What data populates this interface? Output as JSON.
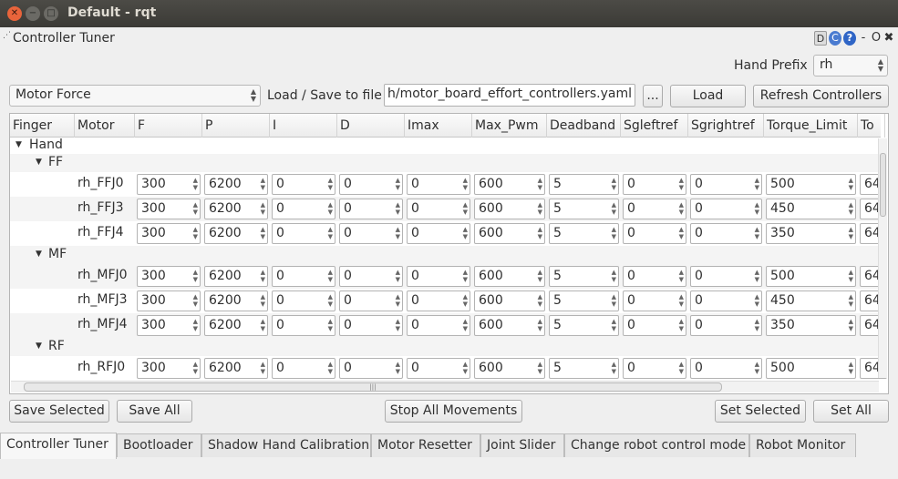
{
  "window": {
    "title": "Default - rqt"
  },
  "plugin": {
    "title": "Controller Tuner",
    "tool_d": "D",
    "tool_c": "C",
    "tool_q": "?",
    "tool_min": "-",
    "tool_float": "O",
    "tool_close": "✖"
  },
  "hand_prefix": {
    "label": "Hand Prefix",
    "value": "rh"
  },
  "controller_type": {
    "value": "Motor Force"
  },
  "file": {
    "label": "Load / Save to file",
    "path": "h/motor_board_effort_controllers.yaml",
    "browse_label": "...",
    "load_label": "Load",
    "refresh_label": "Refresh Controllers"
  },
  "table": {
    "columns": [
      "Finger",
      "Motor",
      "F",
      "P",
      "I",
      "D",
      "Imax",
      "Max_Pwm",
      "Deadband",
      "Sgleftref",
      "Sgrightref",
      "Torque_Limit",
      "To"
    ],
    "root": "Hand",
    "groups": [
      {
        "name": "FF",
        "rows": [
          {
            "motor": "rh_FFJ0",
            "values": [
              "300",
              "6200",
              "0",
              "0",
              "0",
              "600",
              "5",
              "0",
              "0",
              "500",
              "64"
            ]
          },
          {
            "motor": "rh_FFJ3",
            "values": [
              "300",
              "6200",
              "0",
              "0",
              "0",
              "600",
              "5",
              "0",
              "0",
              "450",
              "64"
            ]
          },
          {
            "motor": "rh_FFJ4",
            "values": [
              "300",
              "6200",
              "0",
              "0",
              "0",
              "600",
              "5",
              "0",
              "0",
              "350",
              "64"
            ]
          }
        ]
      },
      {
        "name": "MF",
        "rows": [
          {
            "motor": "rh_MFJ0",
            "values": [
              "300",
              "6200",
              "0",
              "0",
              "0",
              "600",
              "5",
              "0",
              "0",
              "500",
              "64"
            ]
          },
          {
            "motor": "rh_MFJ3",
            "values": [
              "300",
              "6200",
              "0",
              "0",
              "0",
              "600",
              "5",
              "0",
              "0",
              "450",
              "64"
            ]
          },
          {
            "motor": "rh_MFJ4",
            "values": [
              "300",
              "6200",
              "0",
              "0",
              "0",
              "600",
              "5",
              "0",
              "0",
              "350",
              "64"
            ]
          }
        ]
      },
      {
        "name": "RF",
        "rows": [
          {
            "motor": "rh_RFJ0",
            "values": [
              "300",
              "6200",
              "0",
              "0",
              "0",
              "600",
              "5",
              "0",
              "0",
              "500",
              "64"
            ]
          }
        ]
      }
    ]
  },
  "actions": {
    "save_selected": "Save Selected",
    "save_all": "Save All",
    "stop_all": "Stop All Movements",
    "set_selected": "Set Selected",
    "set_all": "Set All"
  },
  "tabs": [
    "Controller Tuner",
    "Bootloader",
    "Shadow Hand Calibration",
    "Motor Resetter",
    "Joint Slider",
    "Change robot control mode",
    "Robot Monitor"
  ],
  "active_tab": "Controller Tuner"
}
